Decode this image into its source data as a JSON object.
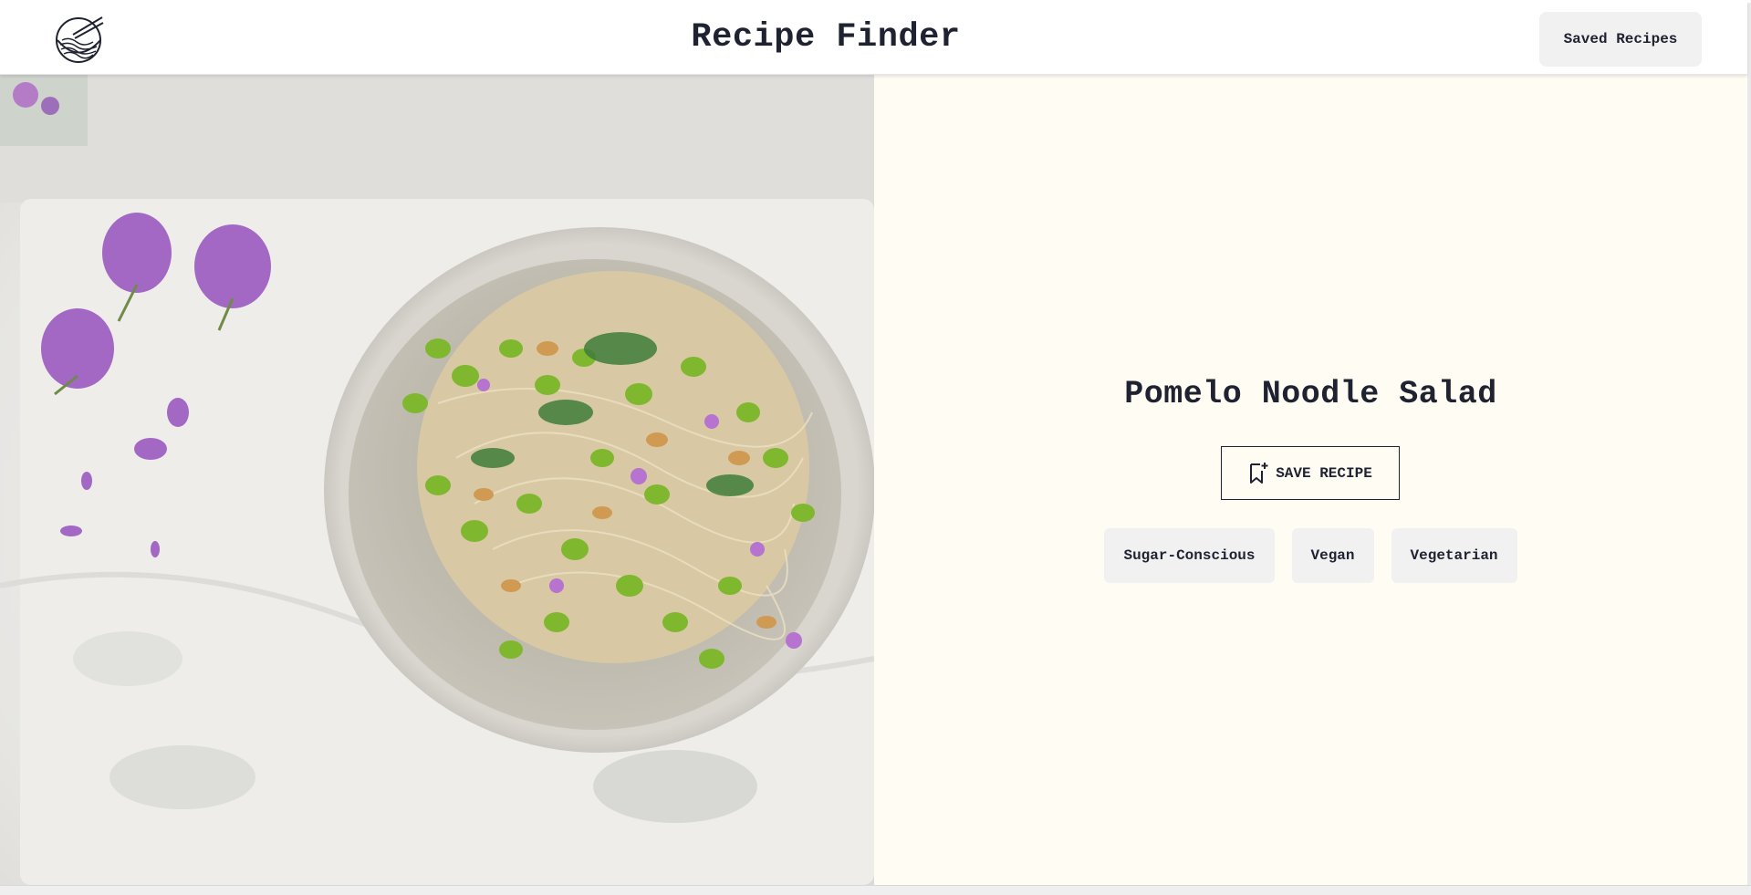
{
  "header": {
    "title": "Recipe Finder",
    "saved_recipes_label": "Saved Recipes",
    "logo_icon": "noodle-bowl-logo-icon"
  },
  "recipe": {
    "name": "Pomelo Noodle Salad",
    "image_icon": "recipe-photo",
    "save_label": "SAVE RECIPE",
    "save_icon": "bookmark-plus-icon",
    "tags": [
      "Sugar-Conscious",
      "Vegan",
      "Vegetarian"
    ]
  },
  "colors": {
    "panel_background": "#fffcf4",
    "text": "#1f2230",
    "button_background": "#f1f1f2"
  }
}
